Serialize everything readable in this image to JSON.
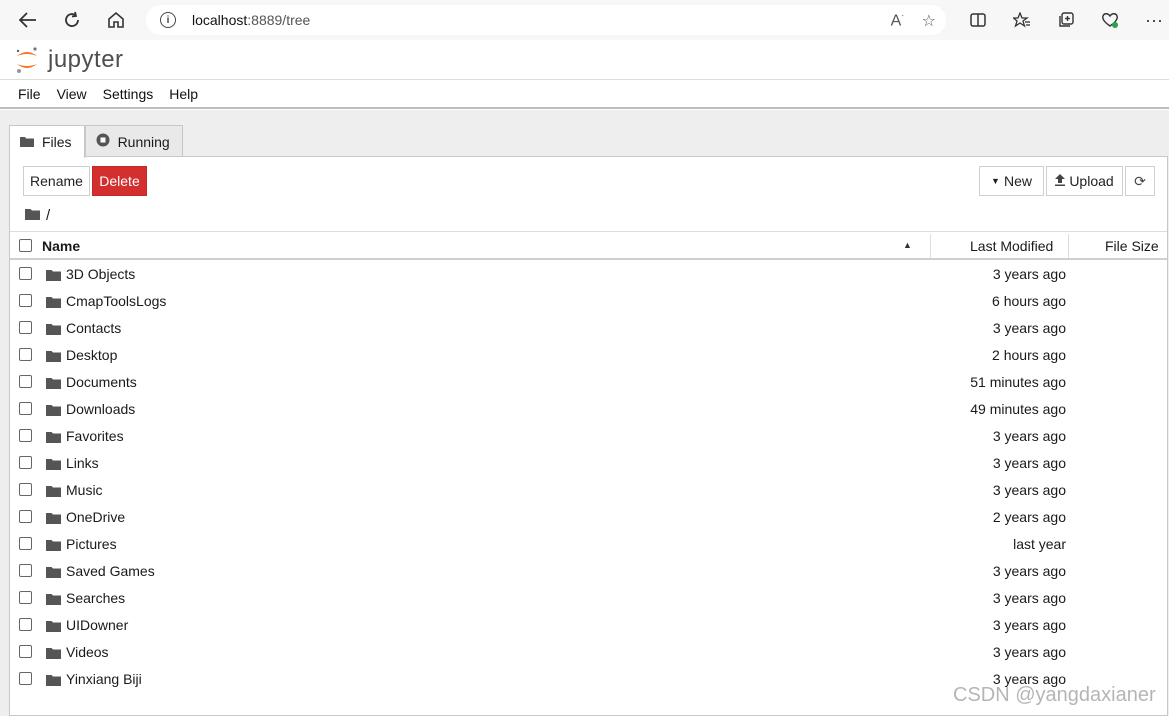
{
  "browser": {
    "url_host": "localhost",
    "url_path": ":8889/tree"
  },
  "app": {
    "logo_text": "jupyter",
    "menu": [
      "File",
      "View",
      "Settings",
      "Help"
    ],
    "tabs": [
      {
        "label": "Files",
        "icon": "folder-icon",
        "active": true
      },
      {
        "label": "Running",
        "icon": "stop-circle-icon",
        "active": false
      }
    ]
  },
  "toolbar": {
    "rename_label": "Rename",
    "delete_label": "Delete",
    "new_label": "New",
    "upload_label": "Upload"
  },
  "breadcrumb": "/",
  "list": {
    "headers": {
      "name": "Name",
      "modified": "Last Modified",
      "size": "File Size"
    },
    "items": [
      {
        "name": "3D Objects",
        "modified": "3 years ago"
      },
      {
        "name": "CmapToolsLogs",
        "modified": "6 hours ago"
      },
      {
        "name": "Contacts",
        "modified": "3 years ago"
      },
      {
        "name": "Desktop",
        "modified": "2 hours ago"
      },
      {
        "name": "Documents",
        "modified": "51 minutes ago"
      },
      {
        "name": "Downloads",
        "modified": "49 minutes ago"
      },
      {
        "name": "Favorites",
        "modified": "3 years ago"
      },
      {
        "name": "Links",
        "modified": "3 years ago"
      },
      {
        "name": "Music",
        "modified": "3 years ago"
      },
      {
        "name": "OneDrive",
        "modified": "2 years ago"
      },
      {
        "name": "Pictures",
        "modified": "last year"
      },
      {
        "name": "Saved Games",
        "modified": "3 years ago"
      },
      {
        "name": "Searches",
        "modified": "3 years ago"
      },
      {
        "name": "UIDowner",
        "modified": "3 years ago"
      },
      {
        "name": "Videos",
        "modified": "3 years ago"
      },
      {
        "name": "Yinxiang Biji",
        "modified": "3 years ago"
      }
    ]
  },
  "watermark": "CSDN @yangdaxianer",
  "colors": {
    "delete": "#d32f2f",
    "logo_orange": "#f37726"
  }
}
